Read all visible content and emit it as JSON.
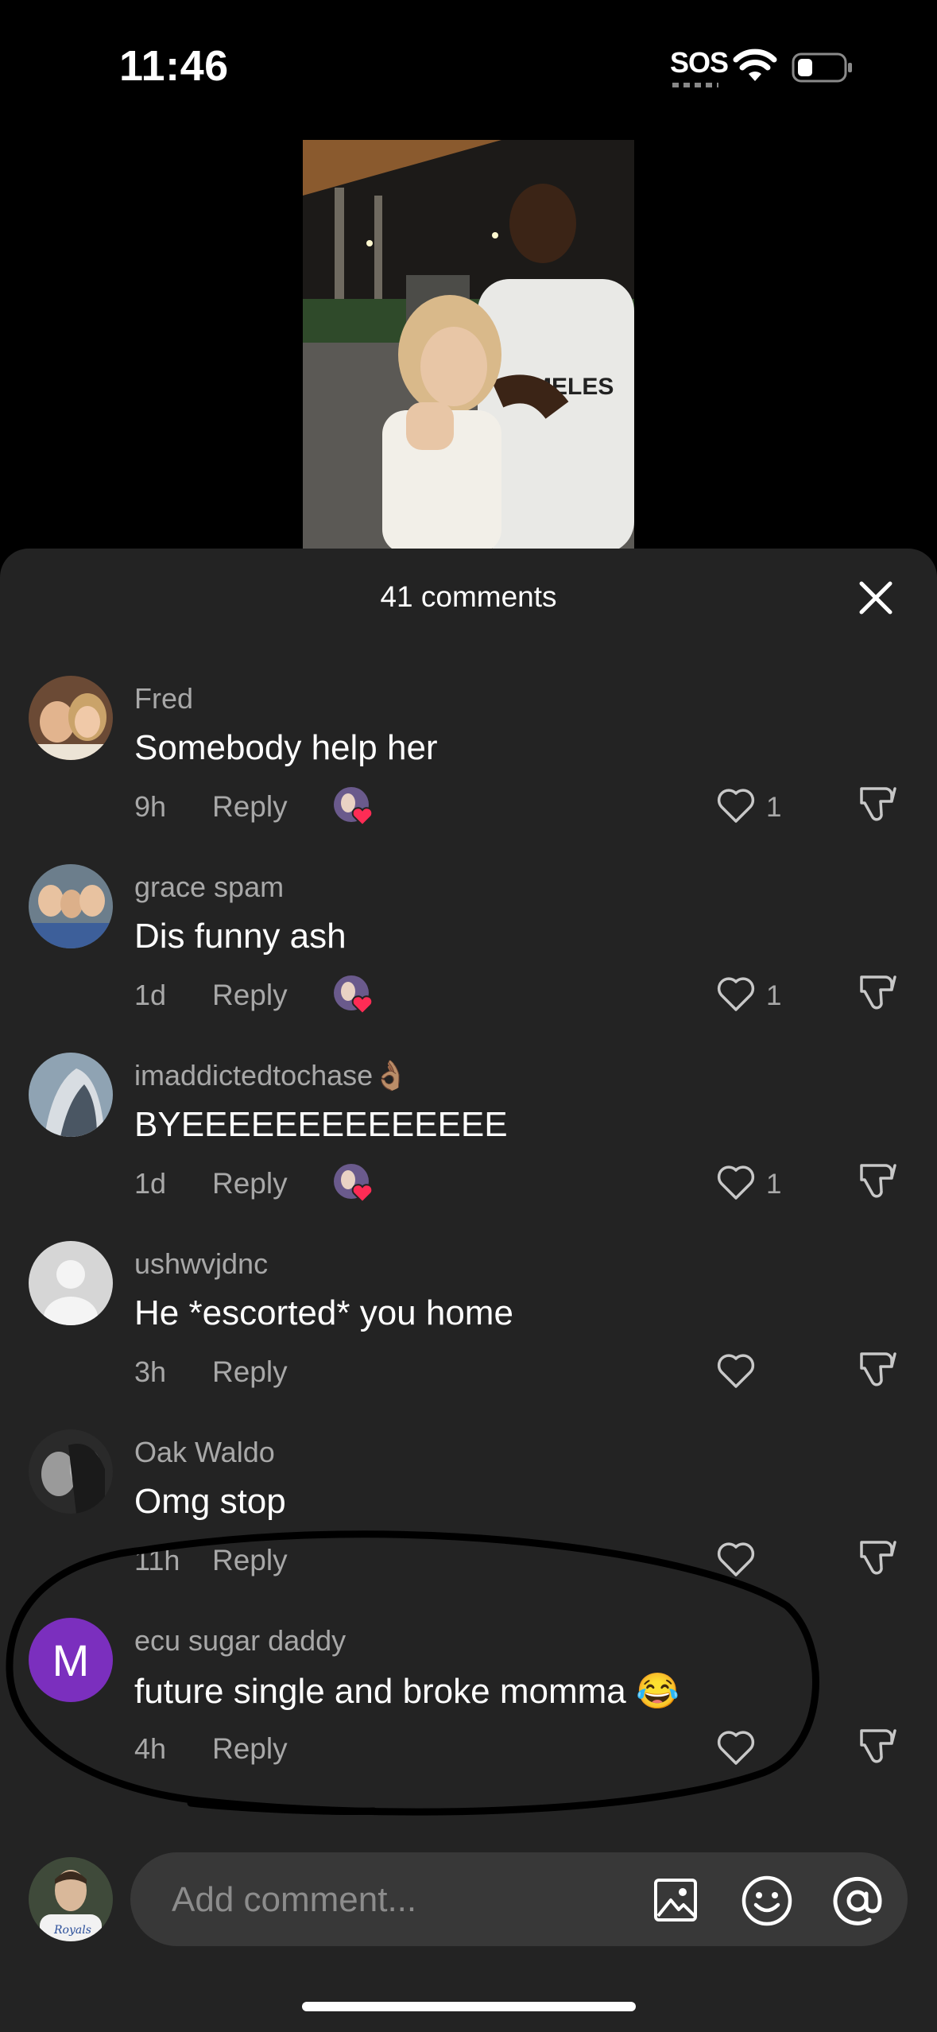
{
  "status_bar": {
    "time": "11:46",
    "sos": "SOS",
    "icons": [
      "wifi-icon",
      "battery-icon"
    ]
  },
  "video": {
    "overlay_text": "MELES"
  },
  "comments_sheet": {
    "title": "41 comments",
    "close_icon": "close-icon",
    "comments": [
      {
        "username": "Fred",
        "text": "Somebody help her",
        "age": "9h",
        "reply_label": "Reply",
        "likes": "1",
        "liked_by_creator": true
      },
      {
        "username": "grace spam",
        "text": "Dis funny ash",
        "age": "1d",
        "reply_label": "Reply",
        "likes": "1",
        "liked_by_creator": true
      },
      {
        "username": "imaddictedtochase👌🏽",
        "text": "BYEEEEEEEEEEEEEE",
        "age": "1d",
        "reply_label": "Reply",
        "likes": "1",
        "liked_by_creator": true
      },
      {
        "username": "ushwvjdnc",
        "text": "He *escorted* you home",
        "age": "3h",
        "reply_label": "Reply",
        "likes": "",
        "liked_by_creator": false
      },
      {
        "username": "Oak Waldo",
        "text": "Omg stop",
        "age": "11h",
        "reply_label": "Reply",
        "likes": "",
        "liked_by_creator": false
      },
      {
        "username": "ecu sugar daddy",
        "text": "future single and broke momma 😂",
        "age": "4h",
        "reply_label": "Reply",
        "likes": "",
        "liked_by_creator": false,
        "avatar_letter": "M"
      }
    ]
  },
  "composer": {
    "placeholder": "Add comment...",
    "icons": [
      "image-icon",
      "emoji-icon",
      "at-icon"
    ],
    "avatar_caption": "Royals"
  },
  "colors": {
    "sheet_bg": "#232323",
    "muted_text": "#a8a8a8",
    "like_red": "#fe2c55",
    "avatar_purple": "#7b2fbe"
  }
}
